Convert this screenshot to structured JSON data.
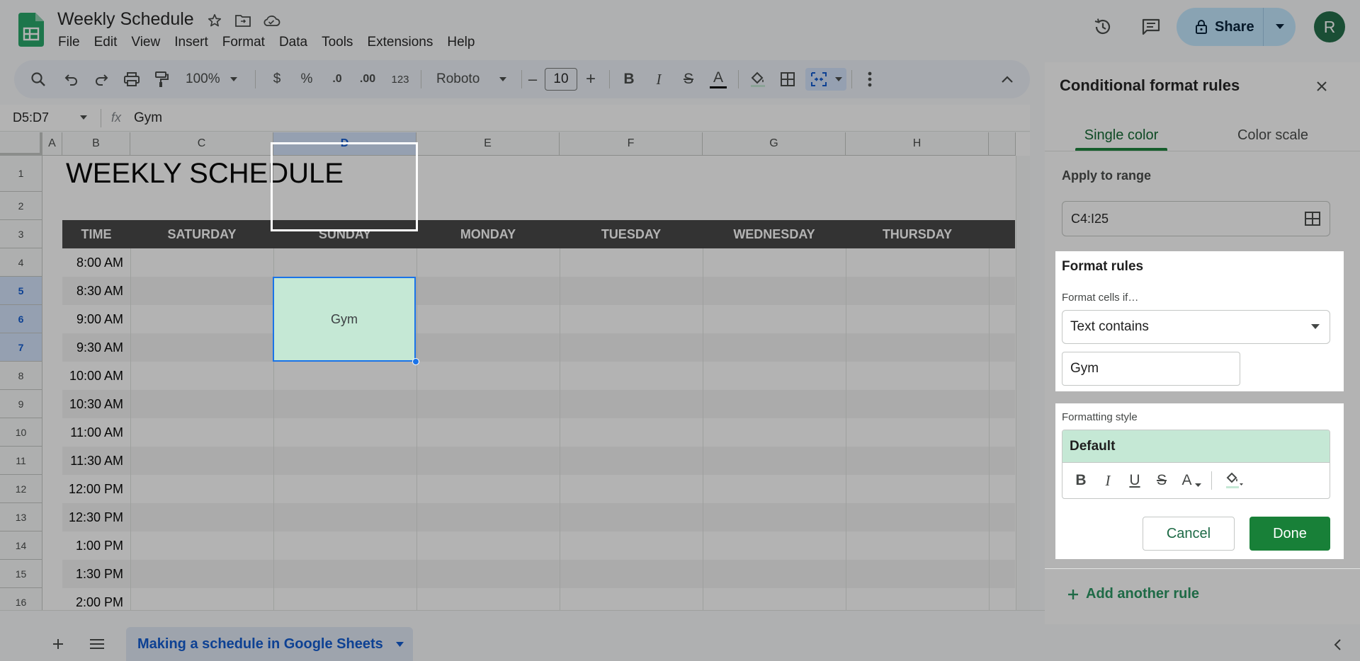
{
  "app": {
    "doc_title": "Weekly Schedule",
    "menus": [
      "File",
      "Edit",
      "View",
      "Insert",
      "Format",
      "Data",
      "Tools",
      "Extensions",
      "Help"
    ],
    "share_label": "Share",
    "avatar_initial": "R",
    "brand_color": "#188038"
  },
  "toolbar": {
    "zoom": "100%",
    "currency": "$",
    "percent": "%",
    "dec_decrease": ".0",
    "dec_increase": ".00",
    "number_format": "123",
    "font": "Roboto",
    "minus": "–",
    "font_size": "10",
    "plus": "+",
    "bold": "B",
    "italic": "I",
    "strike": "S",
    "text_color": "A"
  },
  "formula_bar": {
    "name_box": "D5:D7",
    "fx": "fx",
    "value": "Gym"
  },
  "grid": {
    "columns": [
      "A",
      "B",
      "C",
      "D",
      "E",
      "F",
      "G",
      "H"
    ],
    "selected_column": "D",
    "rows": [
      "1",
      "2",
      "3",
      "4",
      "5",
      "6",
      "7",
      "8",
      "9",
      "10",
      "11",
      "12",
      "13",
      "14",
      "15",
      "16"
    ],
    "selected_rows": [
      "5",
      "6",
      "7"
    ],
    "sheet_title": "WEEKLY SCHEDULE",
    "day_headers": [
      "TIME",
      "SATURDAY",
      "SUNDAY",
      "MONDAY",
      "TUESDAY",
      "WEDNESDAY",
      "THURSDAY"
    ],
    "times": [
      "8:00 AM",
      "8:30 AM",
      "9:00 AM",
      "9:30 AM",
      "10:00 AM",
      "10:30 AM",
      "11:00 AM",
      "11:30 AM",
      "12:00 PM",
      "12:30 PM",
      "1:00 PM",
      "1:30 PM",
      "2:00 PM"
    ],
    "gym_cell": "Gym",
    "header_color": "#434343",
    "highlight_color": "#c5e8d5"
  },
  "bottom": {
    "sheet_tab": "Making a schedule in Google Sheets"
  },
  "panel": {
    "title": "Conditional format rules",
    "tabs": [
      "Single color",
      "Color scale"
    ],
    "apply_label": "Apply to range",
    "range": "C4:I25",
    "rules_heading": "Format rules",
    "cells_if_label": "Format cells if…",
    "condition": "Text contains",
    "value": "Gym",
    "style_label": "Formatting style",
    "style_preview": "Default",
    "style_tools": [
      "B",
      "I",
      "U",
      "S",
      "A"
    ],
    "cancel": "Cancel",
    "done": "Done",
    "add_rule": "Add another rule"
  }
}
